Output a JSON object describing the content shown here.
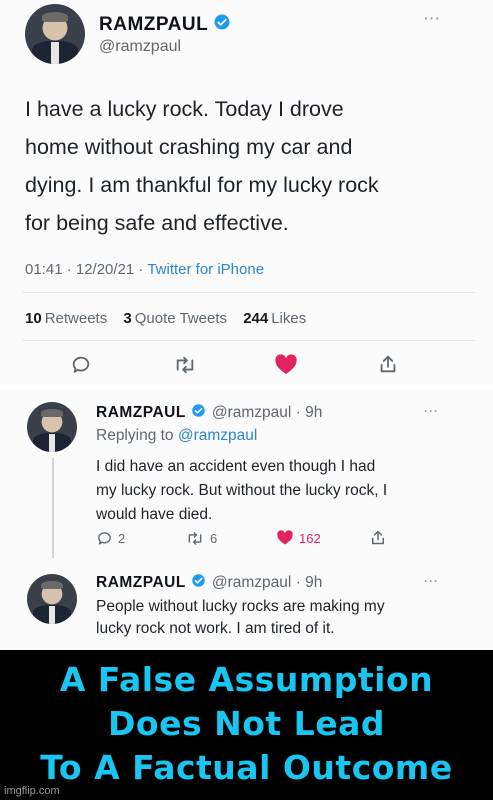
{
  "main_tweet": {
    "author_name": "RAMZPAUL",
    "author_handle": "@ramzpaul",
    "text_lines": [
      "I have a lucky rock. Today I drove",
      "home without crashing my car and",
      "dying. I am thankful for my lucky rock",
      "for being safe and effective."
    ],
    "time": "01:41 · 12/20/21 · ",
    "client": "Twitter for iPhone",
    "retweets_count": "10",
    "retweets_label": "Retweets",
    "quotes_count": "3",
    "quotes_label": "Quote Tweets",
    "likes_count": "244",
    "likes_label": "Likes"
  },
  "reply_1": {
    "author_name": "RAMZPAUL",
    "handle_time": "@ramzpaul · 9h",
    "replying_prefix": "Replying to ",
    "replying_handle": "@ramzpaul",
    "text_lines": [
      "I did have an accident even though I had",
      "my lucky rock. But without the lucky rock, I",
      "would have died."
    ],
    "reply_count": "2",
    "retweet_count": "6",
    "like_count": "162"
  },
  "reply_2": {
    "author_name": "RAMZPAUL",
    "handle_time": "@ramzpaul · 9h",
    "text_lines": [
      "People without lucky rocks are making my",
      "lucky rock not work. I am tired of it."
    ]
  },
  "caption": {
    "lines": [
      "A False Assumption",
      "Does Not Lead",
      "To A Factual Outcome"
    ]
  },
  "watermark": "imgflip.com",
  "icons": {
    "more": "more-horizontal-icon",
    "verified": "verified-badge-icon",
    "reply": "reply-icon",
    "retweet": "retweet-icon",
    "like": "heart-icon",
    "share": "share-icon"
  },
  "colors": {
    "verified": "#1d9bf0",
    "link": "#2e86c9",
    "like": "#e0245e",
    "caption_text": "#19c6f2",
    "caption_bg": "#000000"
  }
}
